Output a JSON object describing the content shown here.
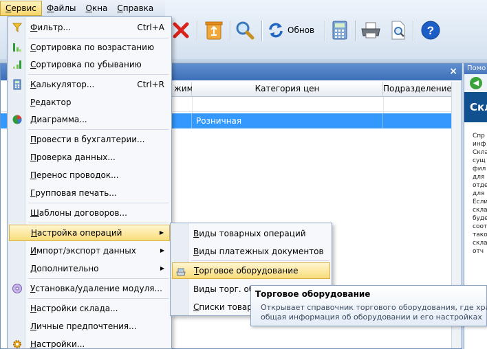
{
  "menubar": {
    "items": [
      {
        "label": "Сервис",
        "u": "С",
        "rest": "ервис"
      },
      {
        "label": "Файлы",
        "u": "Ф",
        "rest": "айлы"
      },
      {
        "label": "Окна",
        "u": "О",
        "rest": "кна"
      },
      {
        "label": "Справка",
        "u": "С",
        "rest": "правка"
      }
    ]
  },
  "toolbar": {
    "refresh_label": "Обнов",
    "icons": [
      "delete-icon",
      "recycle-icon",
      "search-icon",
      "refresh-icon",
      "calculator-icon",
      "printer-icon",
      "print-preview-icon",
      "help-icon"
    ]
  },
  "grid": {
    "columns": [
      "жим",
      "Категория цен",
      "Подразделение"
    ],
    "selected_row": {
      "category": "Розничная"
    }
  },
  "help": {
    "title": "Помо",
    "heading": "Скл",
    "text": "Спр\nинф\nСкла\nсущ\nфил\nдля\nотде\nдля\nЕсли\nскла\nбуде\nсоот\nтако\nскла\nотч"
  },
  "service_menu": {
    "items": [
      {
        "u": "Ф",
        "rest": "ильтр...",
        "shortcut": "Ctrl+A",
        "icon": "filter-icon"
      },
      {
        "u": "С",
        "rest": "ортировка по возрастанию",
        "icon": "sort-ascending-icon"
      },
      {
        "u": "С",
        "rest": "ортировка по убыванию",
        "icon": "sort-descending-icon"
      },
      {
        "u": "К",
        "rest": "алькулятор...",
        "shortcut": "Ctrl+R",
        "icon": "calculator-icon"
      },
      {
        "u": "Р",
        "rest": "едактор",
        "icon": ""
      },
      {
        "u": "Д",
        "rest": "иаграмма...",
        "icon": "pie-chart-icon"
      },
      {
        "u": "П",
        "rest": "ровести в бухгалтерии...",
        "icon": ""
      },
      {
        "u": "П",
        "rest": "роверка данных...",
        "icon": ""
      },
      {
        "u": "П",
        "rest": "еренос проводок...",
        "icon": ""
      },
      {
        "u": "Г",
        "rest": "рупповая печать...",
        "icon": ""
      },
      {
        "u": "Ш",
        "rest": "аблоны договоров...",
        "icon": ""
      },
      {
        "u": "Н",
        "rest": "астройка операций",
        "arrow": "▶",
        "icon": ""
      },
      {
        "u": "И",
        "rest": "мпорт/экспорт данных",
        "arrow": "▶",
        "icon": ""
      },
      {
        "u": "Д",
        "rest": "ополнительно",
        "arrow": "▶",
        "icon": ""
      },
      {
        "u": "У",
        "rest": "становка/удаление модуля...",
        "icon": "disc-icon"
      },
      {
        "u": "Н",
        "rest": "астройки склада...",
        "icon": ""
      },
      {
        "u": "Л",
        "rest": "ичные предпочтения...",
        "icon": ""
      },
      {
        "u": "Н",
        "rest": "астройки...",
        "icon": "gear-icon"
      }
    ]
  },
  "operations_submenu": {
    "items": [
      {
        "u": "В",
        "rest": "иды товарных операций"
      },
      {
        "u": "В",
        "rest": "иды платежных документов"
      },
      {
        "u": "Т",
        "rest": "орговое оборудование"
      },
      {
        "u": "",
        "rest": "Виды торг. об"
      },
      {
        "u": "С",
        "rest": "писки товаров"
      }
    ]
  },
  "tooltip": {
    "title": "Торговое оборудование",
    "line1": "Открывает справочник торгового оборудования, где хранит",
    "line2": "общая информация об оборудовании и его настройках"
  }
}
